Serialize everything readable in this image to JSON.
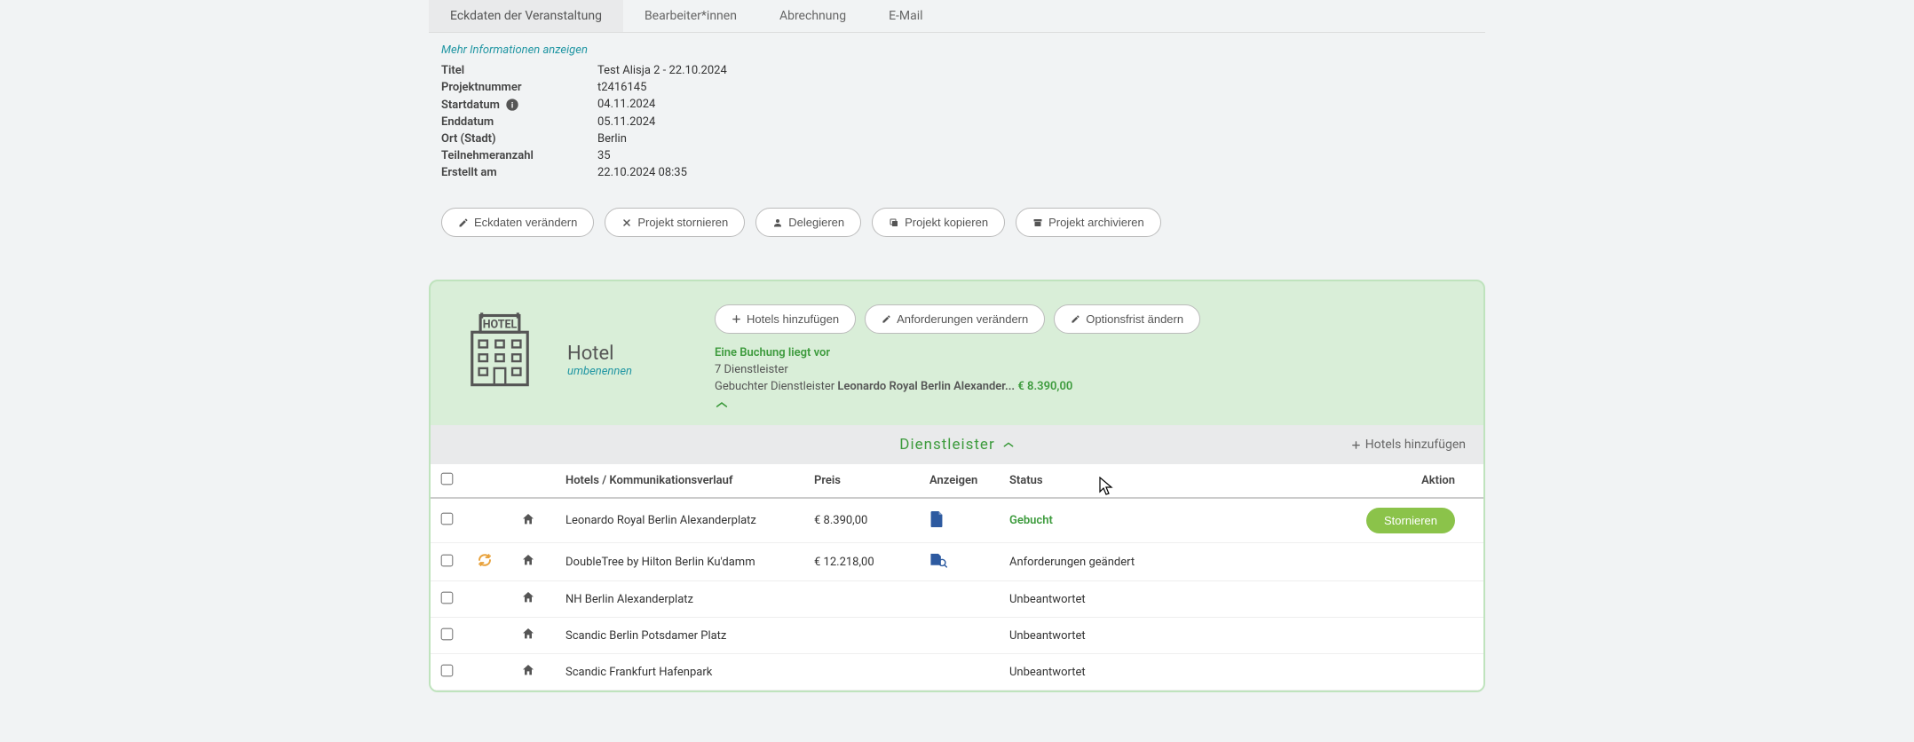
{
  "tabs": {
    "eckdaten": "Eckdaten der Veranstaltung",
    "bearbeiter": "Bearbeiter*innen",
    "abrechnung": "Abrechnung",
    "email": "E-Mail"
  },
  "moreInfo": "Mehr Informationen anzeigen",
  "details": {
    "titelLabel": "Titel",
    "titelValue": "Test Alisja 2 - 22.10.2024",
    "projektnummerLabel": "Projektnummer",
    "projektnummerValue": "t2416145",
    "startdatumLabel": "Startdatum",
    "startdatumValue": "04.11.2024",
    "enddatumLabel": "Enddatum",
    "enddatumValue": "05.11.2024",
    "ortLabel": "Ort (Stadt)",
    "ortValue": "Berlin",
    "teilnehmerLabel": "Teilnehmeranzahl",
    "teilnehmerValue": "35",
    "erstelltLabel": "Erstellt am",
    "erstelltValue": "22.10.2024 08:35"
  },
  "actions": {
    "eckdaten": "Eckdaten verändern",
    "stornieren": "Projekt stornieren",
    "delegieren": "Delegieren",
    "kopieren": "Projekt kopieren",
    "archivieren": "Projekt archivieren"
  },
  "hotelCard": {
    "title": "Hotel",
    "rename": "umbenennen",
    "btnAdd": "Hotels hinzufügen",
    "btnAnforderungen": "Anforderungen verändern",
    "btnOptionsfrist": "Optionsfrist ändern",
    "bookingExists": "Eine Buchung liegt vor",
    "providerCount": "7 Dienstleister",
    "bookedLabel": "Gebuchter Dienstleister ",
    "bookedName": "Leonardo Royal Berlin Alexander...",
    "bookedPrice": "€ 8.390,00"
  },
  "dienst": {
    "title": "Dienstleister",
    "add": "Hotels hinzufügen"
  },
  "tableHead": {
    "hotels": "Hotels / Kommunikationsverlauf",
    "preis": "Preis",
    "anzeigen": "Anzeigen",
    "status": "Status",
    "aktion": "Aktion"
  },
  "rows": [
    {
      "name": "Leonardo Royal Berlin Alexanderplatz",
      "price": "€ 8.390,00",
      "showIcon": "pdf",
      "status": "Gebucht",
      "statusClass": "gebucht",
      "action": "Stornieren",
      "sync": false
    },
    {
      "name": "DoubleTree by Hilton Berlin Ku'damm",
      "price": "€ 12.218,00",
      "showIcon": "search",
      "status": "Anforderungen geändert",
      "statusClass": "",
      "action": "",
      "sync": true
    },
    {
      "name": "NH Berlin Alexanderplatz",
      "price": "",
      "showIcon": "",
      "status": "Unbeantwortet",
      "statusClass": "",
      "action": "",
      "sync": false
    },
    {
      "name": "Scandic Berlin Potsdamer Platz",
      "price": "",
      "showIcon": "",
      "status": "Unbeantwortet",
      "statusClass": "",
      "action": "",
      "sync": false
    },
    {
      "name": "Scandic Frankfurt Hafenpark",
      "price": "",
      "showIcon": "",
      "status": "Unbeantwortet",
      "statusClass": "",
      "action": "",
      "sync": false
    }
  ]
}
